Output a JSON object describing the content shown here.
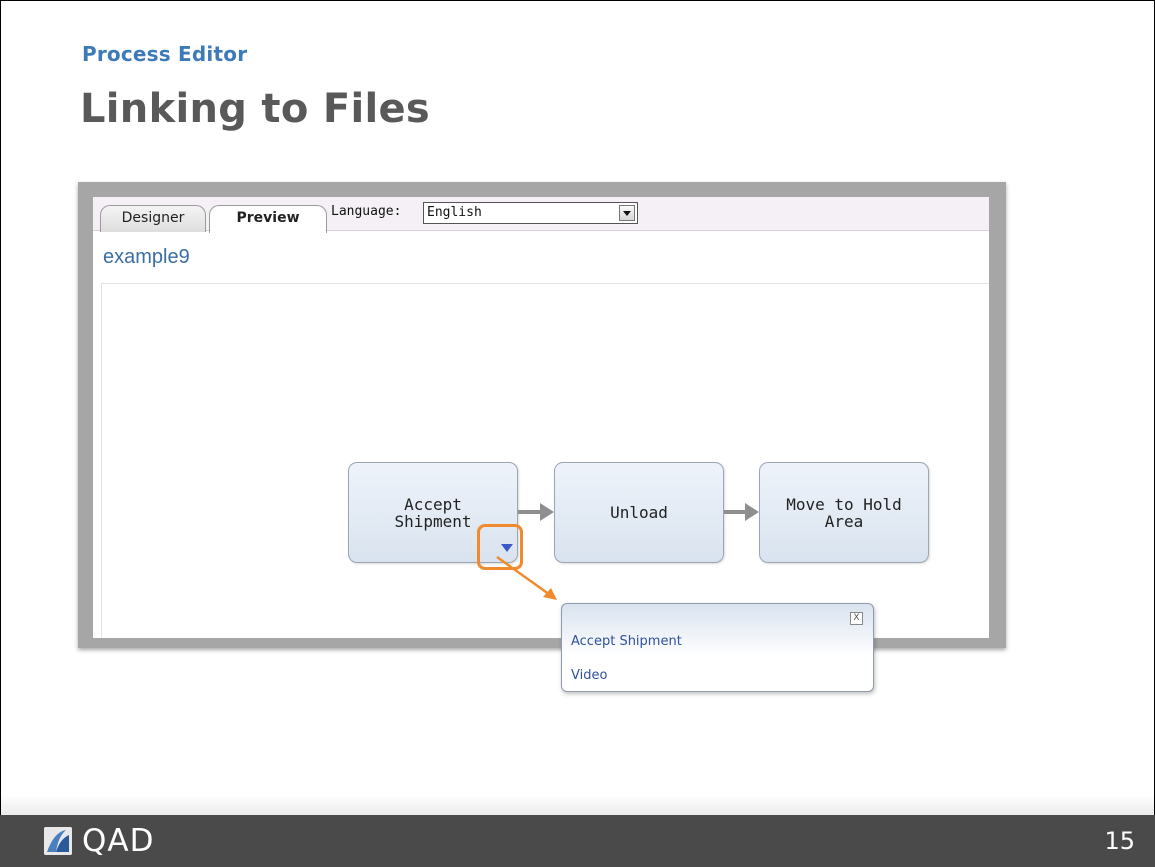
{
  "slide": {
    "section_title": "Process Editor",
    "title": "Linking to Files",
    "page_number": "15"
  },
  "editor": {
    "tabs": [
      {
        "label": "Designer",
        "active": false
      },
      {
        "label": "Preview",
        "active": true
      }
    ],
    "language_label": "Language:",
    "language_value": "English",
    "document_title": "example9"
  },
  "process": {
    "nodes": [
      {
        "label": "Accept\nShipment"
      },
      {
        "label": "Unload"
      },
      {
        "label": "Move to Hold\nArea"
      }
    ]
  },
  "popup": {
    "close_label": "X",
    "title": "Accept Shipment",
    "link": "Video"
  },
  "footer": {
    "logo_text": "QAD"
  },
  "colors": {
    "accent": "#3d7ab8",
    "callout": "#f08a2c",
    "footer_bg": "#4a4a4a"
  },
  "icons": [
    "dropdown-arrow-icon",
    "node-menu-icon",
    "close-icon",
    "qad-logo-icon"
  ]
}
